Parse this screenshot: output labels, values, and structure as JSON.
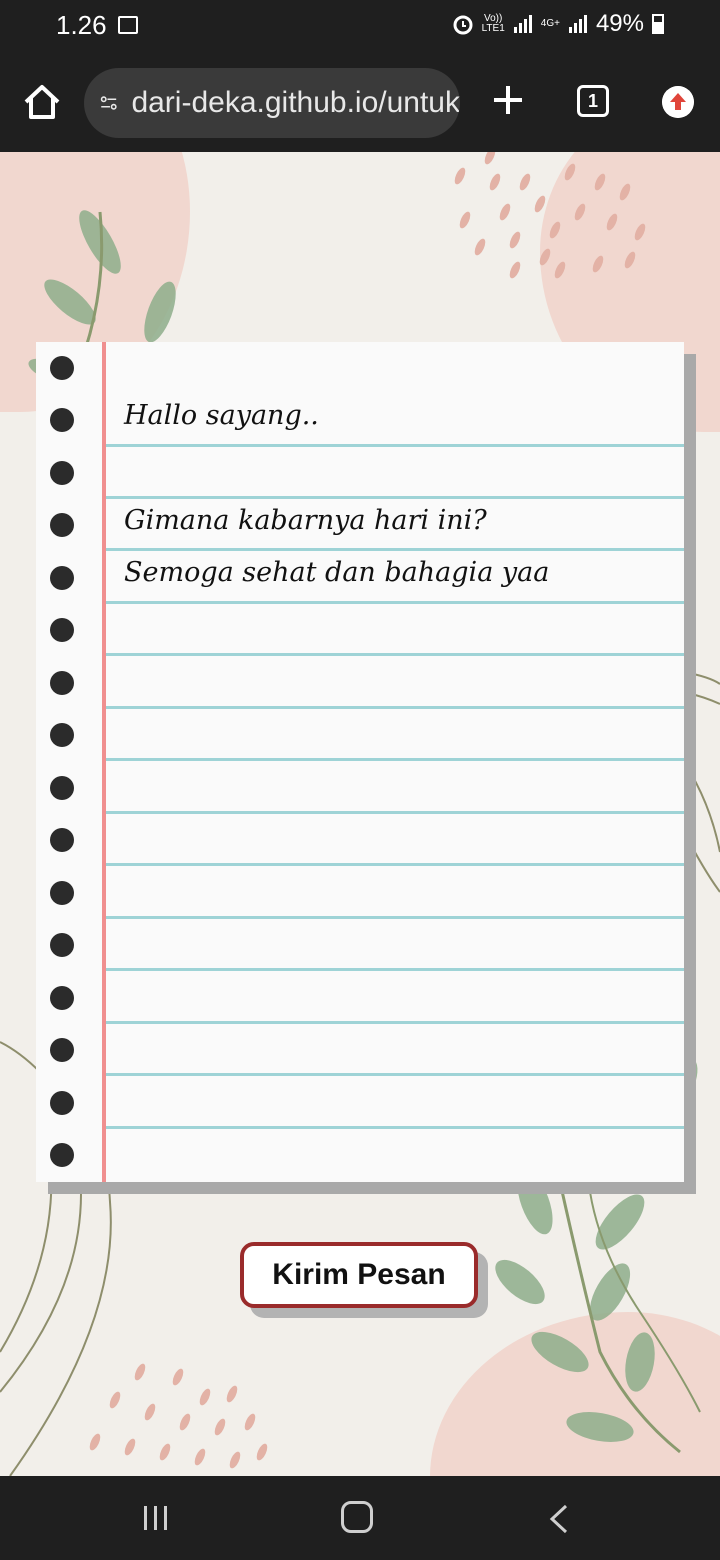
{
  "status_bar": {
    "time": "1.26",
    "volte_label": "Vo))",
    "lte_label": "LTE1",
    "network_label": "4G+",
    "battery": "49%"
  },
  "browser": {
    "url": "dari-deka.github.io/untuk",
    "tab_count": "1"
  },
  "note": {
    "lines": [
      "Hallo sayang..",
      "",
      "Gimana kabarnya hari ini?",
      "Semoga sehat dan bahagia yaa"
    ]
  },
  "button": {
    "label": "Kirim Pesan"
  },
  "colors": {
    "accent_border": "#9a2b2b",
    "margin_line": "#f08f8f",
    "ruled_line": "#9ed3d6",
    "blob": "#f1d7cf"
  }
}
